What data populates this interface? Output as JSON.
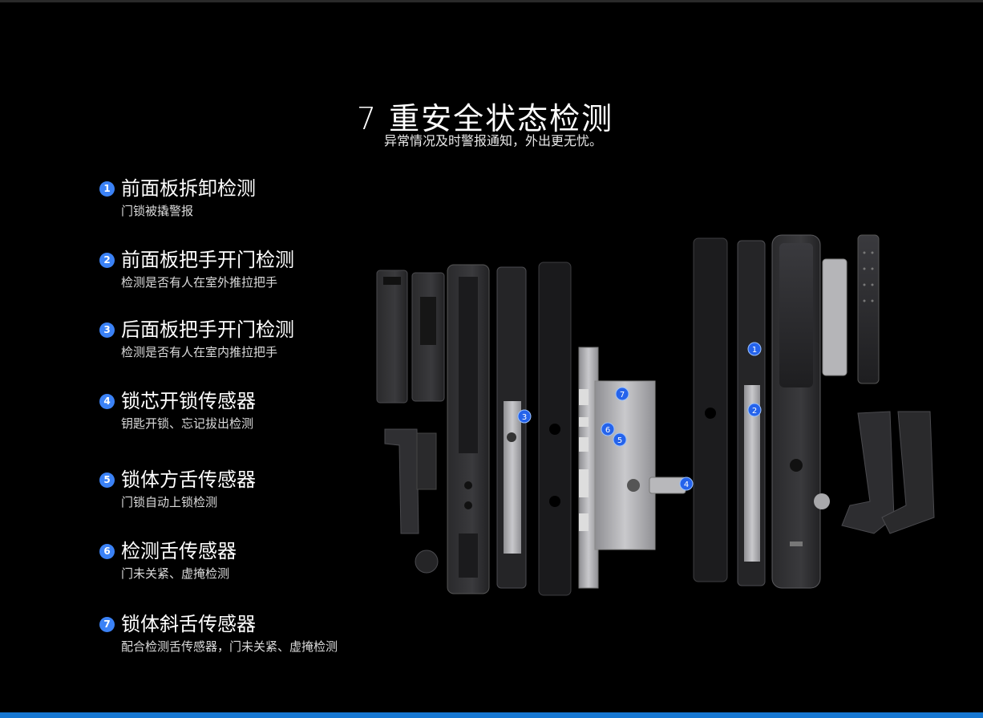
{
  "header": {
    "title": "7 重安全状态检测",
    "subtitle": "异常情况及时警报通知，外出更无忧。"
  },
  "features": [
    {
      "number": "1",
      "title": "前面板拆卸检测",
      "desc": "门锁被撬警报"
    },
    {
      "number": "2",
      "title": "前面板把手开门检测",
      "desc": "检测是否有人在室外推拉把手"
    },
    {
      "number": "3",
      "title": "后面板把手开门检测",
      "desc": "检测是否有人在室内推拉把手"
    },
    {
      "number": "4",
      "title": "锁芯开锁传感器",
      "desc": "钥匙开锁、忘记拔出检测"
    },
    {
      "number": "5",
      "title": "锁体方舌传感器",
      "desc": "门锁自动上锁检测"
    },
    {
      "number": "6",
      "title": "检测舌传感器",
      "desc": "门未关紧、虚掩检测"
    },
    {
      "number": "7",
      "title": "锁体斜舌传感器",
      "desc": "配合检测舌传感器，门未关紧、虚掩检测"
    }
  ],
  "diagram": {
    "callouts": [
      "1",
      "2",
      "3",
      "4",
      "5",
      "6",
      "7"
    ],
    "accent_color": "#2563eb",
    "bottom_bar_color": "#1677d2"
  }
}
